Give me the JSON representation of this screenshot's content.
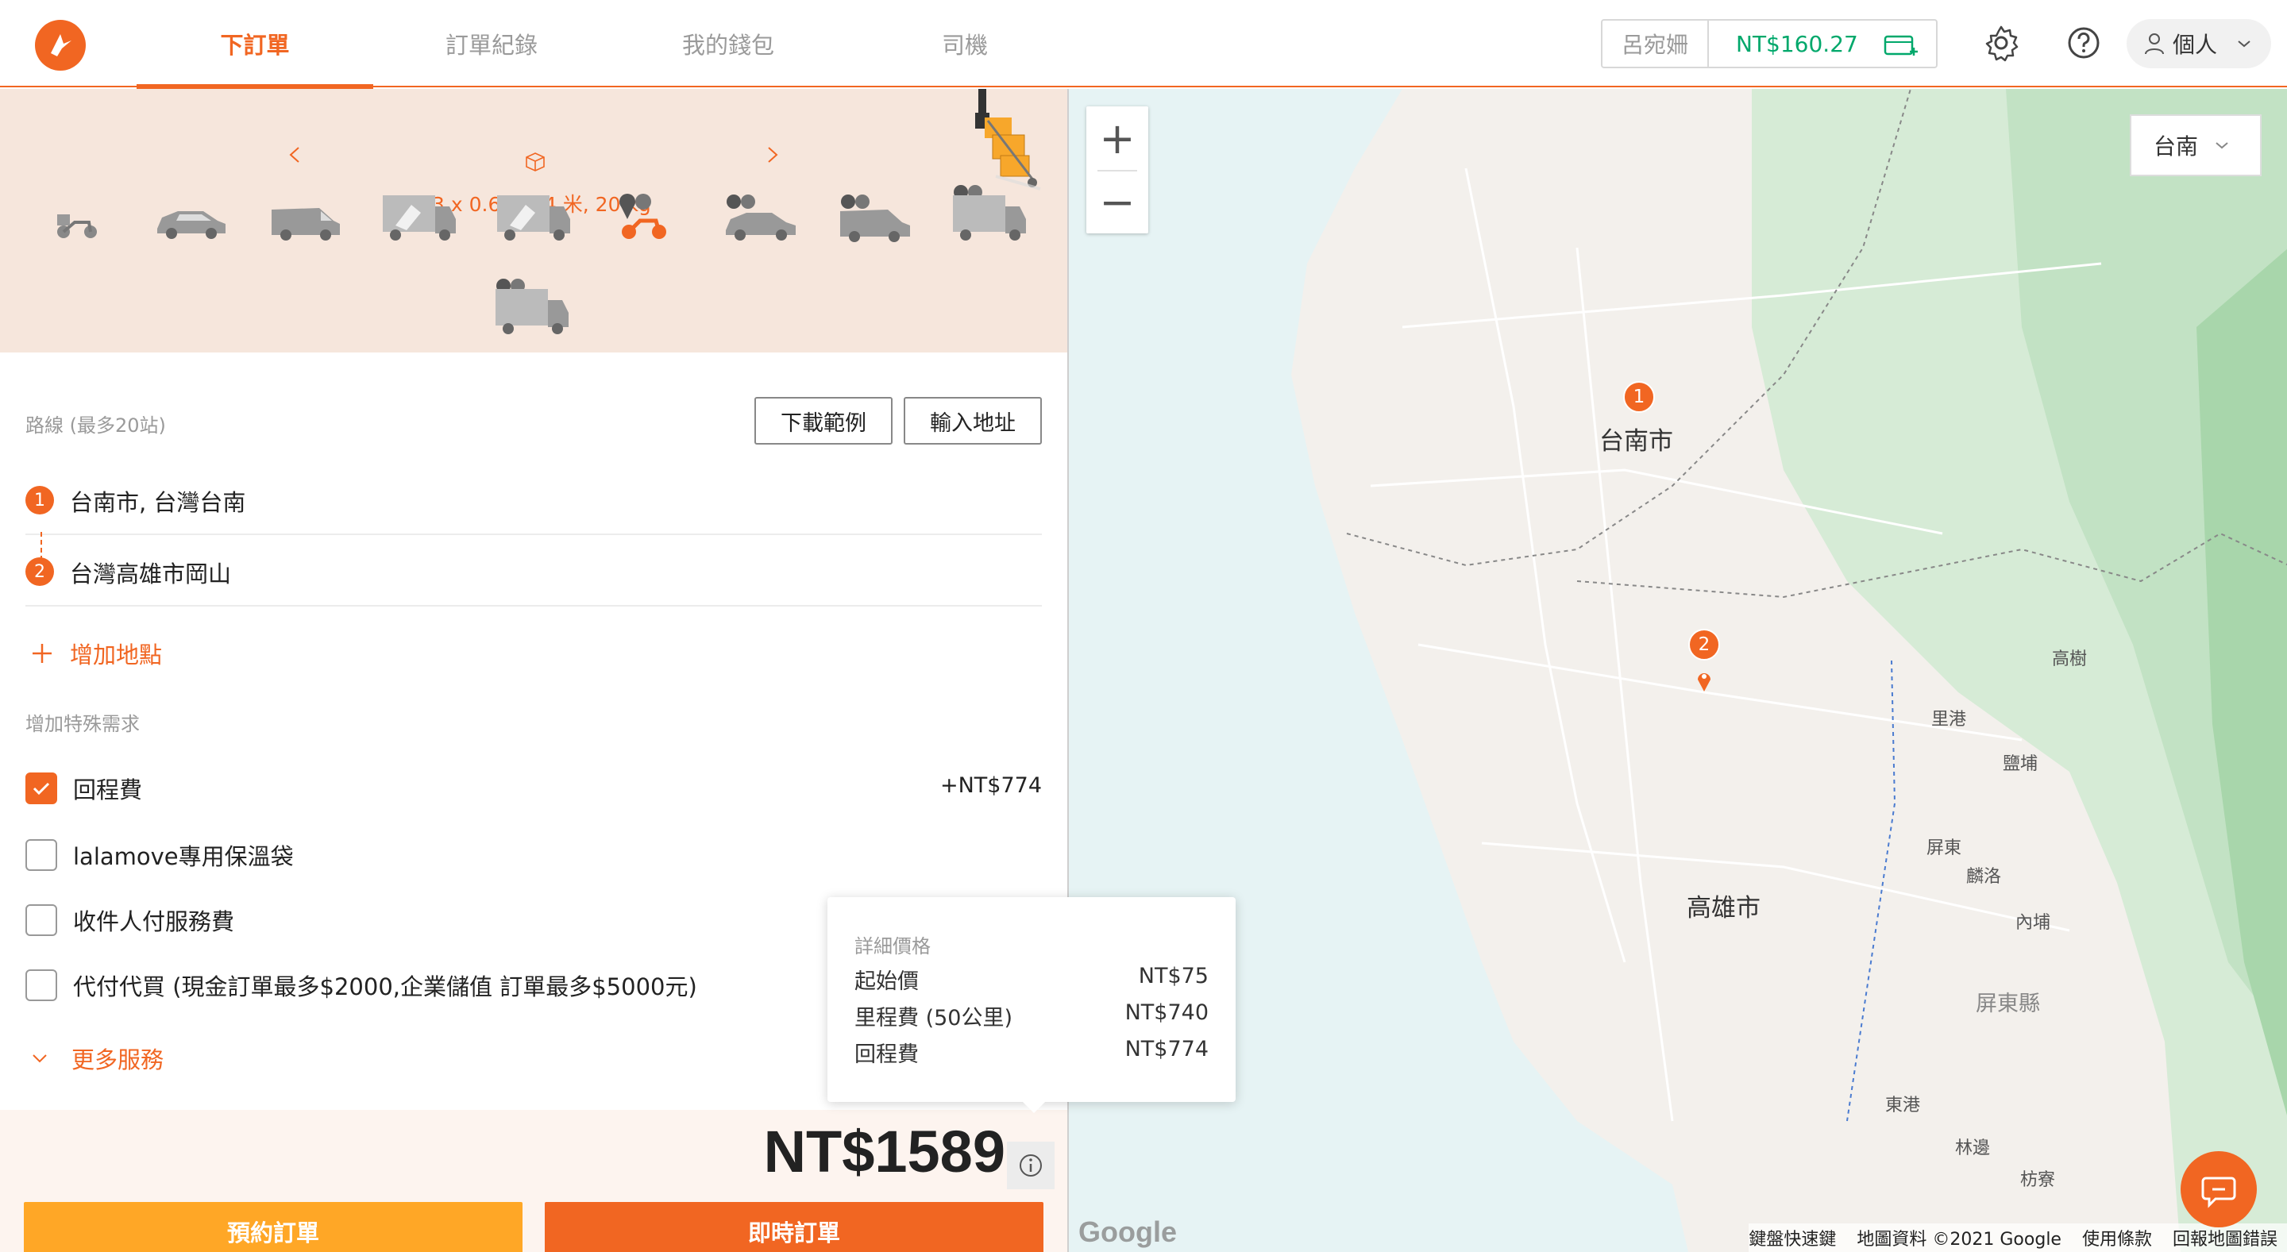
{
  "header": {
    "nav_tabs": [
      "下訂單",
      "訂單紀錄",
      "我的錢包",
      "司機"
    ],
    "user_name": "呂宛姍",
    "wallet_balance": "NT$160.27",
    "profile_label": "個人"
  },
  "vehicle_panel": {
    "dimensions_text": "0.3 x 0.6 x 0.4 米, 20 kg",
    "vehicles": [
      "motorcycle",
      "car",
      "van",
      "small-truck",
      "truck",
      "motorcycle-selected",
      "car-express",
      "van-express",
      "truck-express",
      "truck-large-express"
    ]
  },
  "route": {
    "label": "路線 (最多20站)",
    "download_example_label": "下載範例",
    "input_address_label": "輸入地址",
    "stops": [
      {
        "number": "1",
        "address": "台南市, 台灣台南"
      },
      {
        "number": "2",
        "address": "台灣高雄市岡山"
      }
    ],
    "add_stop_label": "增加地點"
  },
  "special_requests": {
    "label": "增加特殊需求",
    "options": [
      {
        "label": "回程費",
        "checked": true,
        "price": "+NT$774"
      },
      {
        "label": "lalamove專用保溫袋",
        "checked": false,
        "price": ""
      },
      {
        "label": "收件人付服務費",
        "checked": false,
        "price": ""
      },
      {
        "label": "代付代買 (現金訂單最多$2000,企業儲值 訂單最多$5000元)",
        "checked": false,
        "price": ""
      }
    ],
    "more_services_label": "更多服務"
  },
  "price_popup": {
    "title": "詳細價格",
    "rows": [
      {
        "label": "起始價",
        "value": "NT$75"
      },
      {
        "label": "里程費 (50公里)",
        "value": "NT$740"
      },
      {
        "label": "回程費",
        "value": "NT$774"
      }
    ]
  },
  "footer": {
    "total_price": "NT$1589",
    "book_label": "預約訂單",
    "order_now_label": "即時訂單"
  },
  "map": {
    "city_selected": "台南",
    "markers": [
      "1",
      "2"
    ],
    "cities": [
      "台南市",
      "高雄市",
      "屏東縣"
    ],
    "places": [
      "高樹",
      "里港",
      "鹽埔",
      "屏東",
      "麟洛",
      "內埔",
      "東港",
      "林邊",
      "枋寮"
    ],
    "logo_text": "Google",
    "footer_links": [
      "鍵盤快速鍵",
      "地圖資料 ©2021 Google",
      "使用條款",
      "回報地圖錯誤"
    ]
  },
  "colors": {
    "accent": "#f16622",
    "secondary": "#ffa726",
    "balance": "#00a86b"
  }
}
